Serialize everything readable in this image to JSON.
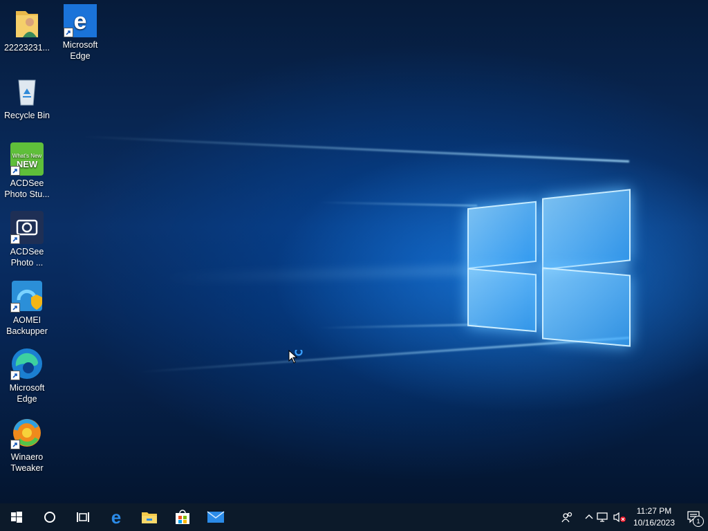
{
  "desktop": {
    "icons": [
      {
        "label": "22223231..."
      },
      {
        "label": "Microsoft Edge"
      },
      {
        "label": "Recycle Bin"
      },
      {
        "label": "ACDSee Photo Stu..."
      },
      {
        "label": "ACDSee Photo ..."
      },
      {
        "label": "AOMEI Backupper"
      },
      {
        "label": "Microsoft Edge"
      },
      {
        "label": "Winaero Tweaker"
      }
    ],
    "shortcut_badge": "What's New"
  },
  "taskbar": {
    "pinned": [
      "start-icon",
      "cortana-icon",
      "task-view-icon",
      "edge-legacy-icon",
      "file-explorer-icon",
      "store-icon",
      "mail-icon"
    ],
    "tray": {
      "time": "11:27 PM",
      "date": "10/16/2023",
      "notification_count": "1"
    }
  },
  "colors": {
    "taskbar": "#0c1a2a",
    "accent": "#0078d7",
    "desktop_dark": "#061b3a"
  }
}
